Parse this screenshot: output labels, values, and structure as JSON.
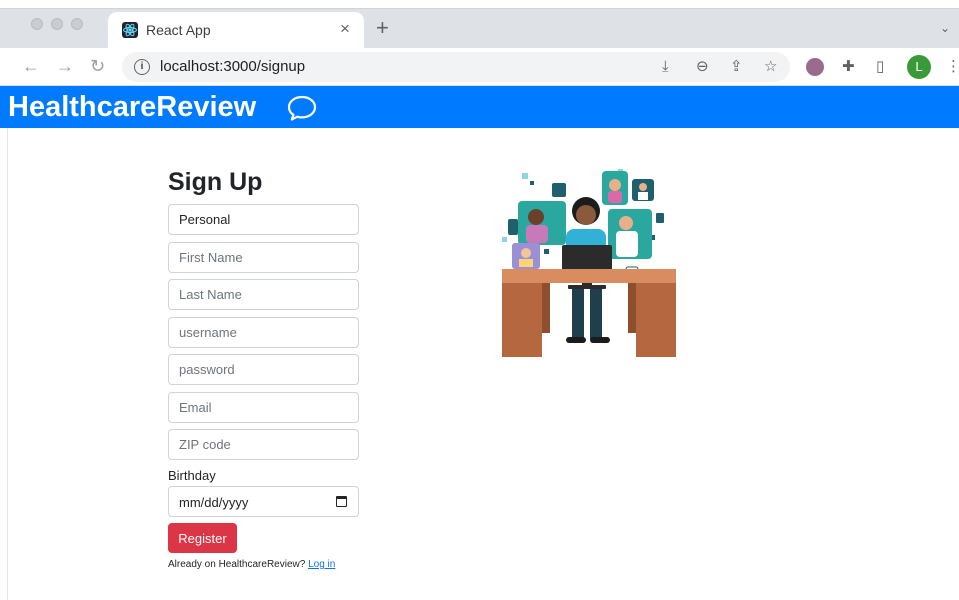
{
  "browser": {
    "tab": {
      "title": "React App",
      "close_glyph": "×"
    },
    "new_tab_glyph": "+",
    "tab_list_glyph": "⌄",
    "nav": {
      "back_glyph": "←",
      "forward_glyph": "→",
      "reload_glyph": "↻"
    },
    "address": {
      "url": "localhost:3000/signup",
      "info_glyph": "i"
    },
    "omni_icons": {
      "install": "⤓",
      "zoom": "⊖",
      "share": "⇪",
      "bookmark": "☆"
    },
    "extension_icons": {
      "puzzle": "✚",
      "sidepanel": "▯",
      "menu": "⋮"
    },
    "profile_initial": "L"
  },
  "app": {
    "brand": "HealthcareReview",
    "brand_color": "#007bff"
  },
  "signup": {
    "title": "Sign Up",
    "account_type": {
      "value": "Personal"
    },
    "fields": {
      "first_name": {
        "placeholder": "First Name"
      },
      "last_name": {
        "placeholder": "Last Name"
      },
      "username": {
        "placeholder": "username"
      },
      "password": {
        "placeholder": "password"
      },
      "email": {
        "placeholder": "Email"
      },
      "zip": {
        "placeholder": "ZIP code"
      }
    },
    "birthday_label": "Birthday",
    "birthday_placeholder": "mm/dd/yyyy",
    "register_label": "Register",
    "register_color": "#dc3545",
    "already_text": "Already on HealthcareReview?",
    "login_link": "Log in"
  },
  "icons": {
    "chat": "chat-bubble-icon",
    "calendar": "calendar-icon",
    "favicon": "react-logo-icon"
  }
}
